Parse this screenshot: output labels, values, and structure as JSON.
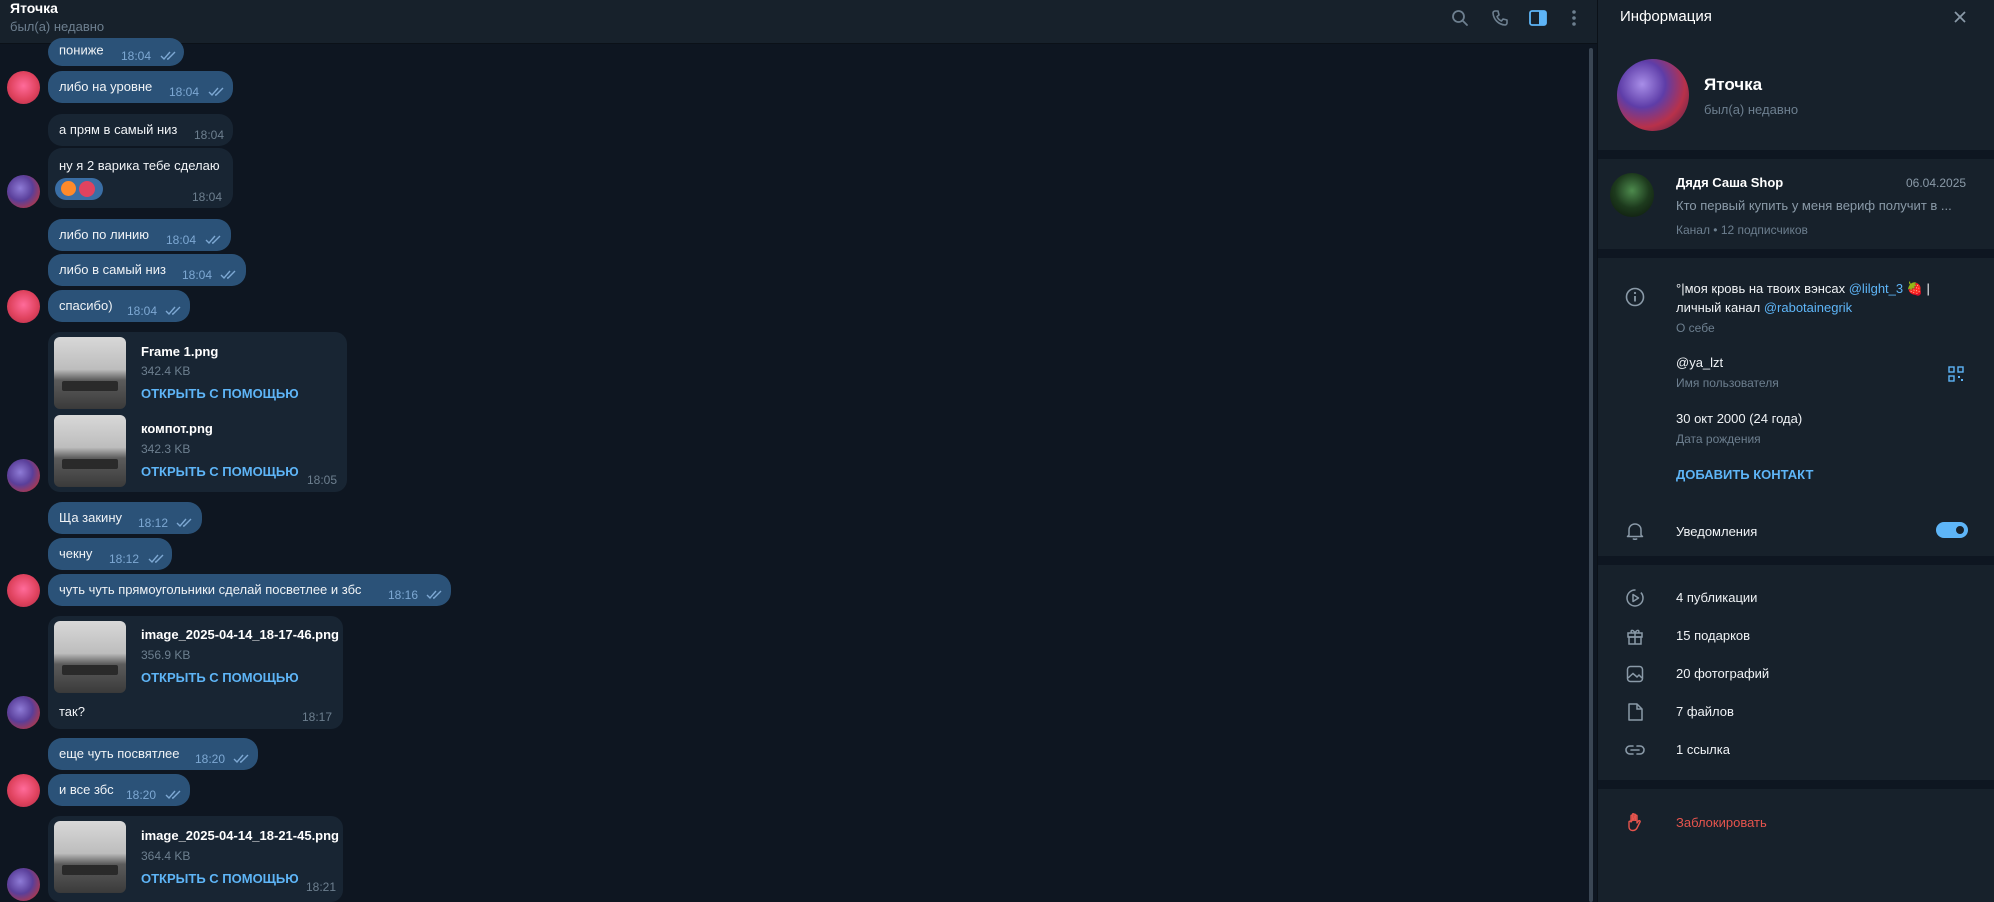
{
  "header": {
    "title": "Яточка",
    "status": "был(а) недавно"
  },
  "messages": {
    "m1": {
      "text": "пониже",
      "time": "18:04"
    },
    "m2": {
      "text": "либо на уровне",
      "time": "18:04"
    },
    "m3": {
      "text": "а прям в самый низ",
      "time": "18:04"
    },
    "m4": {
      "text": "ну я 2 варика тебе сделаю",
      "time": "18:04"
    },
    "m5": {
      "text": "либо по линию",
      "time": "18:04"
    },
    "m6": {
      "text": "либо в самый низ",
      "time": "18:04"
    },
    "m7": {
      "text": "спасибо)",
      "time": "18:04"
    },
    "m8": {
      "text": "Ща закину",
      "time": "18:12"
    },
    "m9": {
      "text": "чекну",
      "time": "18:12"
    },
    "m10": {
      "text": "чуть чуть прямоугольники сделай посветлее и збс",
      "time": "18:16"
    },
    "m11": {
      "text": "еще чуть посвятлее",
      "time": "18:20"
    },
    "m12": {
      "text": "и все збс",
      "time": "18:20"
    }
  },
  "files": {
    "f1": {
      "name": "Frame 1.png",
      "size": "342.4 KB",
      "action": "ОТКРЫТЬ С ПОМОЩЬЮ"
    },
    "f2": {
      "name": "компот.png",
      "size": "342.3 KB",
      "action": "ОТКРЫТЬ С ПОМОЩЬЮ",
      "time": "18:05"
    },
    "f3": {
      "name": "image_2025-04-14_18-17-46.png",
      "size": "356.9 KB",
      "action": "ОТКРЫТЬ С ПОМОЩЬЮ",
      "caption": "так?",
      "time": "18:17"
    },
    "f4": {
      "name": "image_2025-04-14_18-21-45.png",
      "size": "364.4 KB",
      "action": "ОТКРЫТЬ С ПОМОЩЬЮ",
      "time": "18:21"
    }
  },
  "info": {
    "title": "Информация",
    "name": "Яточка",
    "status": "был(а) недавно",
    "channel": {
      "name": "Дядя Саша Shop",
      "date": "06.04.2025",
      "preview": "Кто первый купить у меня вериф получит в ...",
      "meta": "Канал • 12 подписчиков"
    },
    "bio": {
      "line1_text": "°|моя кровь на твоих вэнсах ",
      "line1_link": "@lilght_3",
      "line1_end": " 🍓 |",
      "line2_text": "личный канал ",
      "line2_link": "@rabotainegrik",
      "label": "О себе"
    },
    "username": {
      "value": "@ya_lzt",
      "label": "Имя пользователя"
    },
    "birthday": {
      "value": "30 окт 2000 (24 года)",
      "label": "Дата рождения"
    },
    "add_contact": "ДОБАВИТЬ КОНТАКТ",
    "notifications": {
      "label": "Уведомления",
      "enabled": true
    },
    "media": {
      "posts": "4 публикации",
      "gifts": "15 подарков",
      "photos": "20 фотографий",
      "files": "7 файлов",
      "links": "1 ссылка"
    },
    "block": "Заблокировать"
  },
  "colors": {
    "background": "#0e1621",
    "panel": "#17212b",
    "incoming_bubble": "#182533",
    "outgoing_bubble": "#2b5278",
    "accent": "#5eb5f7",
    "danger": "#e5544d"
  }
}
